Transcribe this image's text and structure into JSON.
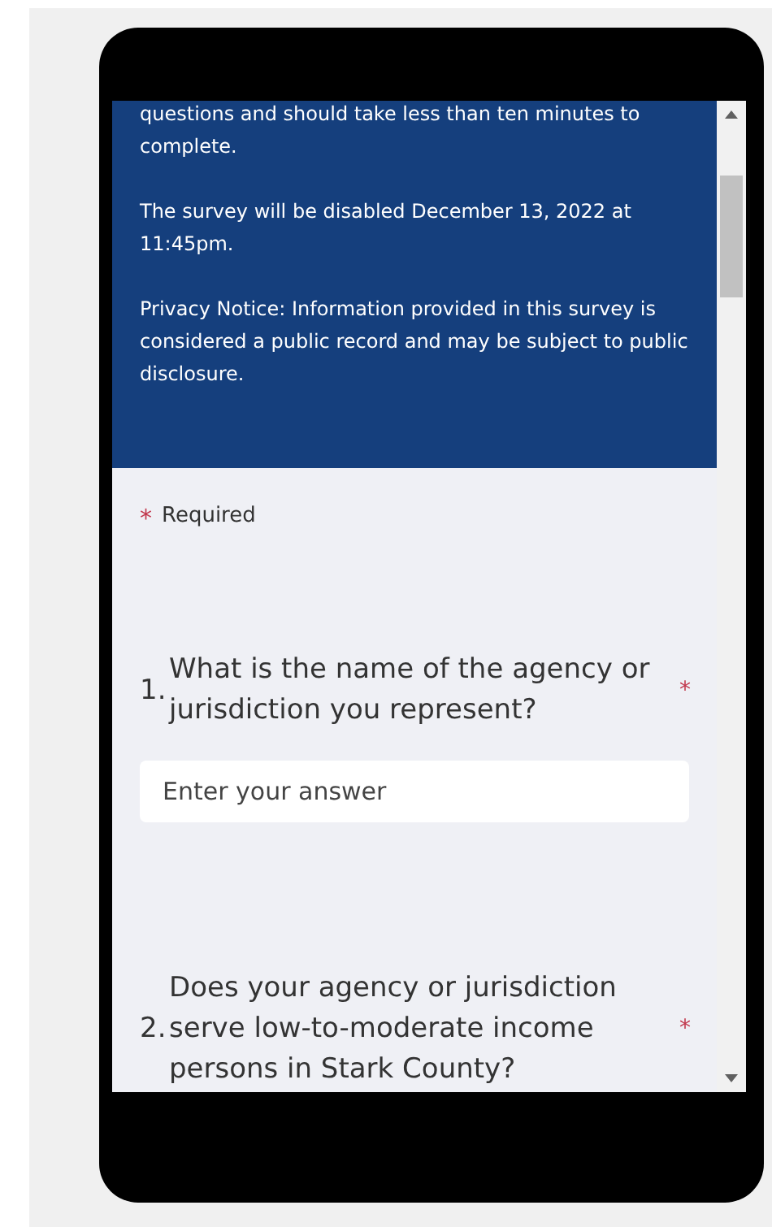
{
  "header": {
    "paragraphs": [
      "questions and should take less than ten minutes to complete.",
      "The survey will be disabled December 13, 2022 at 11:45pm.",
      "Privacy Notice: Information provided in this survey is considered a public record and may be subject to public disclosure."
    ]
  },
  "required_note": {
    "marker": "*",
    "label": "Required"
  },
  "questions": [
    {
      "number": "1.",
      "text": "What is the name of the agency or jurisdiction you represent?",
      "required_mark": "*",
      "kind": "text",
      "placeholder": "Enter your answer"
    },
    {
      "number": "2.",
      "text": "Does your agency or jurisdiction serve low-to-moderate income persons in Stark County?",
      "required_mark": "*",
      "kind": "choice"
    }
  ]
}
